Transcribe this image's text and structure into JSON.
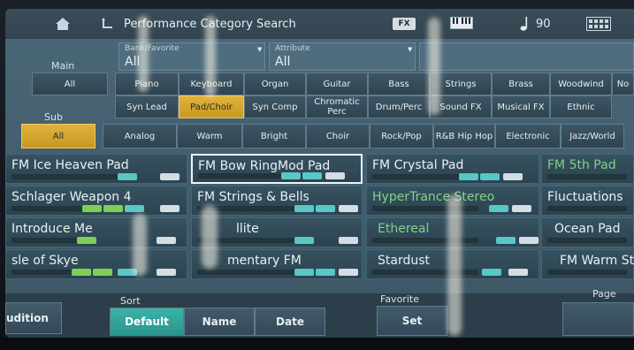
{
  "header": {
    "title": "Performance Category Search",
    "fx_label": "FX",
    "tempo": "90",
    "icons": [
      "home-icon",
      "back-icon",
      "keyboard-icon",
      "note-icon",
      "grid-icon"
    ]
  },
  "filters": {
    "bank_favorite_label": "Bank/Favorite",
    "bank_favorite_value": "All",
    "attribute_label": "Attribute",
    "attribute_value": "All"
  },
  "main": {
    "label": "Main",
    "items": [
      "All",
      "Piano",
      "Keyboard",
      "Organ",
      "Guitar",
      "Bass",
      "Strings",
      "Brass",
      "Woodwind",
      "Syn Lead",
      "Pad/Choir",
      "Syn Comp",
      "Chromatic Perc",
      "Drum/Perc",
      "Sound FX",
      "Musical FX",
      "Ethnic",
      "No"
    ],
    "selected": "Pad/Choir"
  },
  "sub": {
    "label": "Sub",
    "items": [
      "All",
      "Analog",
      "Warm",
      "Bright",
      "Choir",
      "Rock/Pop",
      "R&B Hip Hop",
      "Electronic",
      "Jazz/World"
    ],
    "selected": "All"
  },
  "results": {
    "items": [
      {
        "name": "FM Ice Heaven Pad",
        "color": "white"
      },
      {
        "name": "FM Bow RingMod Pad",
        "color": "white",
        "selected": true
      },
      {
        "name": "FM Crystal Pad",
        "color": "white"
      },
      {
        "name": "FM 5th Pad",
        "color": "green"
      },
      {
        "name": "Schlager Weapon 4",
        "color": "white"
      },
      {
        "name": "FM Strings & Bells",
        "color": "white"
      },
      {
        "name": "HyperTrance Stereo",
        "color": "green"
      },
      {
        "name": "Fluctuations",
        "color": "white"
      },
      {
        "name": "Introduce Me",
        "color": "white"
      },
      {
        "name": "llite",
        "color": "white"
      },
      {
        "name": "Ethereal",
        "color": "green"
      },
      {
        "name": "Ocean Pad",
        "color": "white"
      },
      {
        "name": "sle of Skye",
        "color": "white"
      },
      {
        "name": "mentary FM",
        "color": "white"
      },
      {
        "name": "Stardust",
        "color": "white"
      },
      {
        "name": "FM Warm St",
        "color": "white"
      }
    ]
  },
  "bottom": {
    "audition_label": "udition",
    "sort_label": "Sort",
    "sort_options": [
      "Default",
      "Name",
      "Date"
    ],
    "sort_selected": "Default",
    "favorite_label": "Favorite",
    "favorite_set": "Set",
    "page_label": "Page"
  },
  "colors": {
    "selected_category": "#d4a52c",
    "selected_sort": "#33a99f",
    "screen_bg": "#45606f"
  }
}
